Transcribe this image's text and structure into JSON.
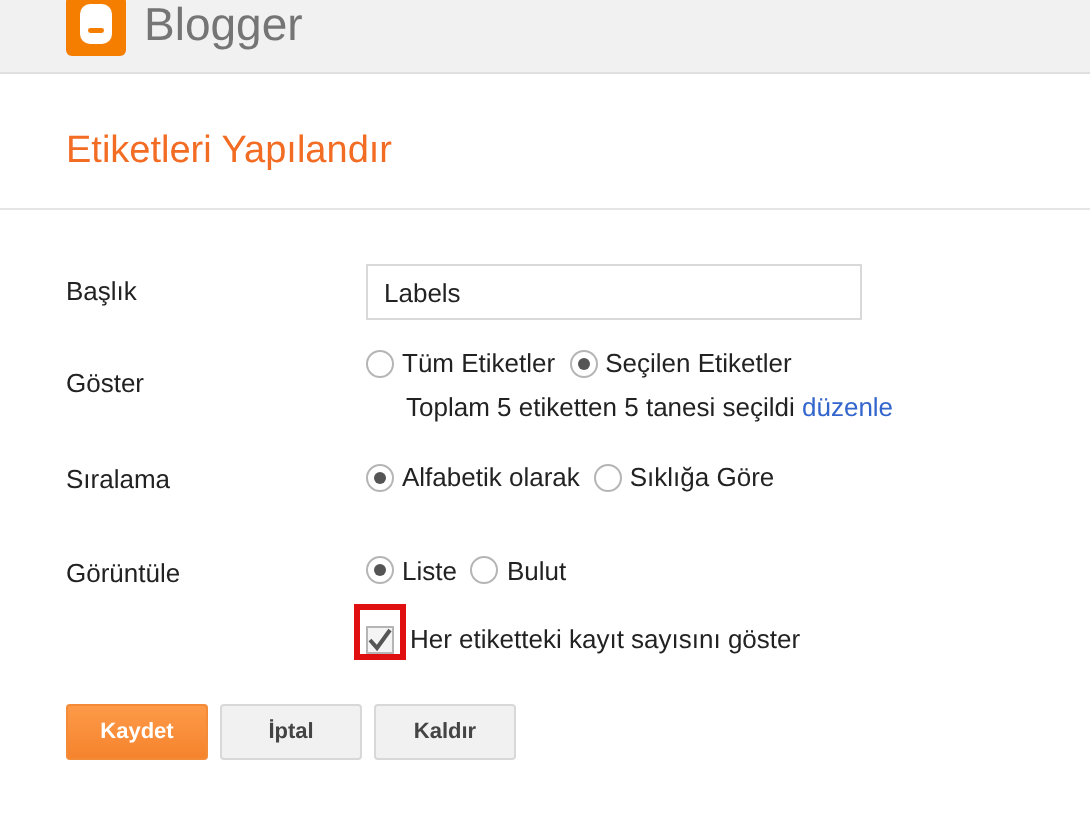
{
  "header": {
    "brand": "Blogger"
  },
  "title": "Etiketleri Yapılandır",
  "fields": [
    {
      "kind": "text",
      "label": "Başlık",
      "value": "Labels"
    },
    {
      "kind": "radio",
      "label": "Göster",
      "options": [
        {
          "label": "Tüm Etiketler",
          "selected": false
        },
        {
          "label": "Seçilen Etiketler",
          "selected": true
        }
      ],
      "note": "Toplam 5 etiketten 5 tanesi seçildi",
      "link": "düzenle"
    },
    {
      "kind": "radio",
      "label": "Sıralama",
      "options": [
        {
          "label": "Alfabetik olarak",
          "selected": true
        },
        {
          "label": "Sıklığa Göre",
          "selected": false
        }
      ]
    },
    {
      "kind": "radio",
      "label": "Görüntüle",
      "options": [
        {
          "label": "Liste",
          "selected": true
        },
        {
          "label": "Bulut",
          "selected": false
        }
      ]
    },
    {
      "kind": "checkbox",
      "label": "Her etiketteki kayıt sayısını göster",
      "checked": true,
      "highlighted": true
    }
  ],
  "buttons": [
    {
      "label": "Kaydet",
      "primary": true
    },
    {
      "label": "İptal",
      "primary": false
    },
    {
      "label": "Kaldır",
      "primary": false
    }
  ]
}
